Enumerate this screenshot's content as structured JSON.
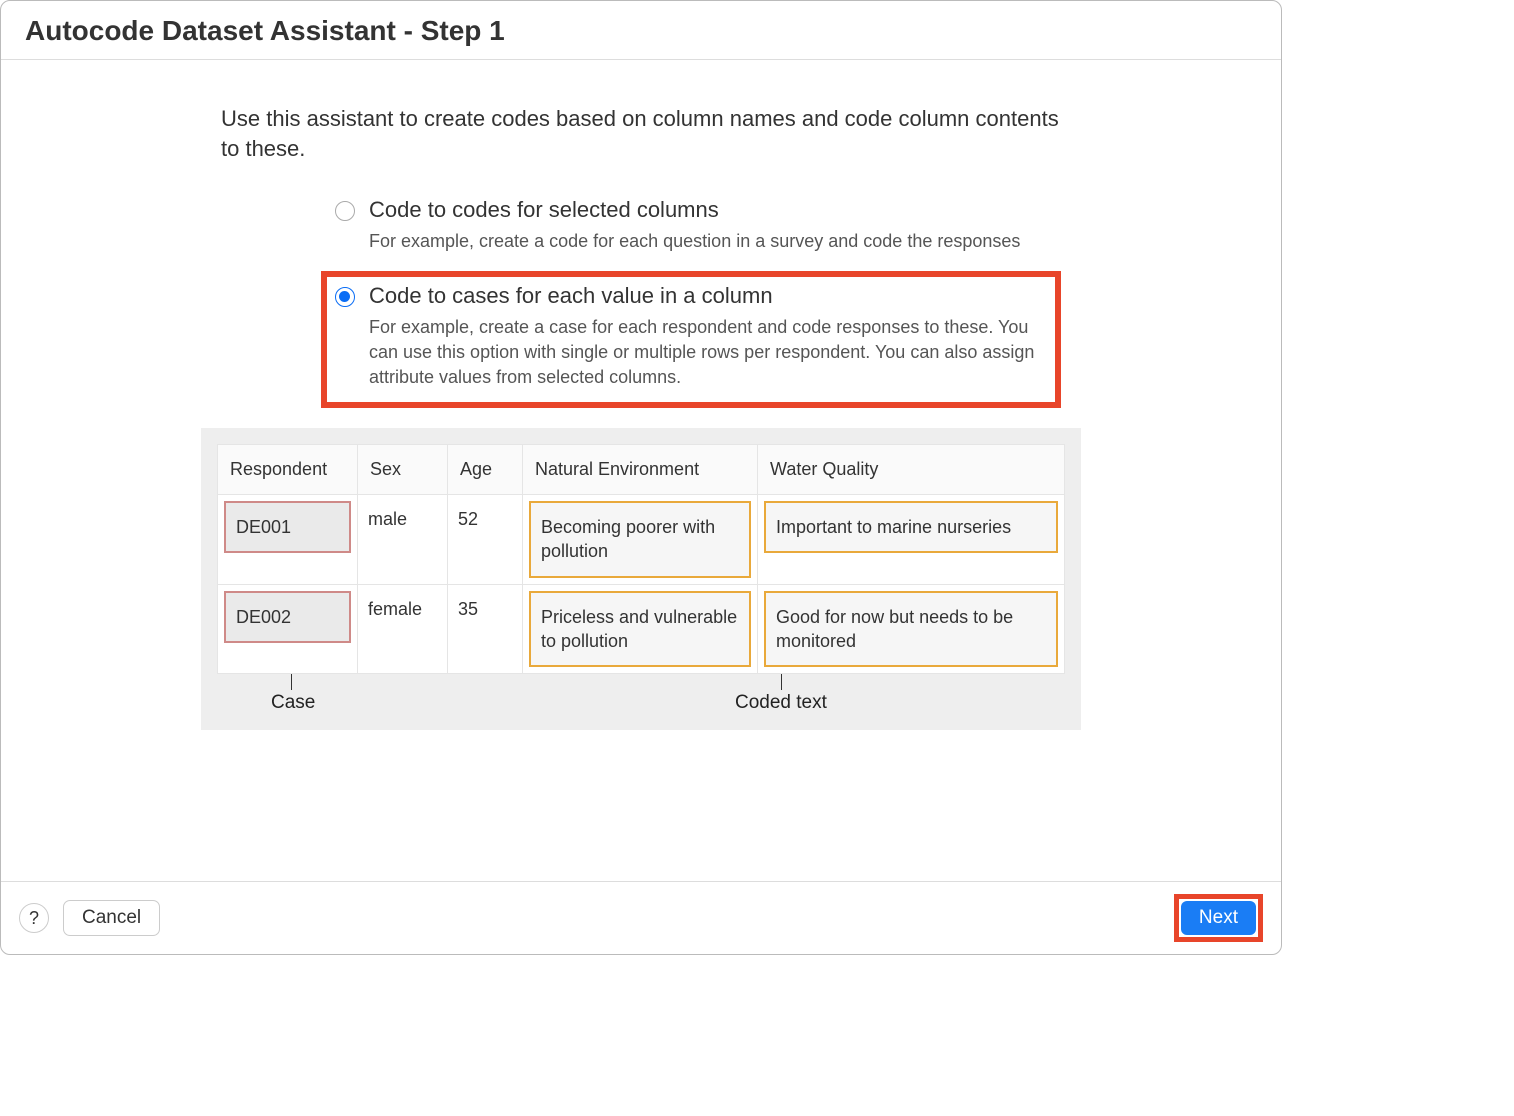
{
  "window": {
    "title": "Autocode Dataset Assistant - Step 1"
  },
  "intro": "Use this assistant to create codes based on column names and code column contents to these.",
  "options": [
    {
      "label": "Code to codes for selected columns",
      "desc": "For example, create a code for each question in a survey and code the responses",
      "selected": false,
      "highlighted": false
    },
    {
      "label": "Code to cases for each value in a column",
      "desc": "For example, create a case for each respondent and code responses to these. You can use this option with single or multiple rows per respondent. You can also assign attribute values from selected columns.",
      "selected": true,
      "highlighted": true
    }
  ],
  "example": {
    "headers": [
      "Respondent",
      "Sex",
      "Age",
      "Natural Environment",
      "Water Quality"
    ],
    "rows": [
      {
        "respondent": "DE001",
        "sex": "male",
        "age": "52",
        "natural_environment": "Becoming poorer with pollution",
        "water_quality": "Important to marine nurseries"
      },
      {
        "respondent": "DE002",
        "sex": "female",
        "age": "35",
        "natural_environment": "Priceless and vulnerable to pollution",
        "water_quality": "Good for now but needs to be monitored"
      }
    ],
    "label_case": "Case",
    "label_coded": "Coded text"
  },
  "footer": {
    "help": "?",
    "cancel": "Cancel",
    "next": "Next"
  }
}
